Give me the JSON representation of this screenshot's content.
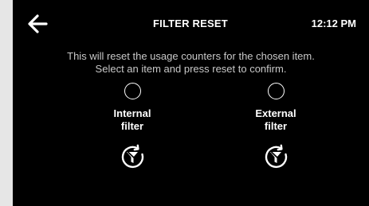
{
  "header": {
    "back_icon": "arrow-left-icon",
    "title": "FILTER RESET",
    "time": "12:12 PM"
  },
  "instructions": {
    "line1": "This will reset the usage counters for the chosen item.",
    "line2": "Select an item and press reset to confirm."
  },
  "options": [
    {
      "label_line1": "Internal",
      "label_line2": "filter",
      "selected": false,
      "reset_icon": "filter-reset-icon"
    },
    {
      "label_line1": "External",
      "label_line2": "filter",
      "selected": false,
      "reset_icon": "filter-reset-icon"
    }
  ],
  "colors": {
    "screen_bg": "#000000",
    "bezel": "#e6e6e6",
    "text": "#ffffff",
    "muted_text": "#c8c8c8"
  }
}
